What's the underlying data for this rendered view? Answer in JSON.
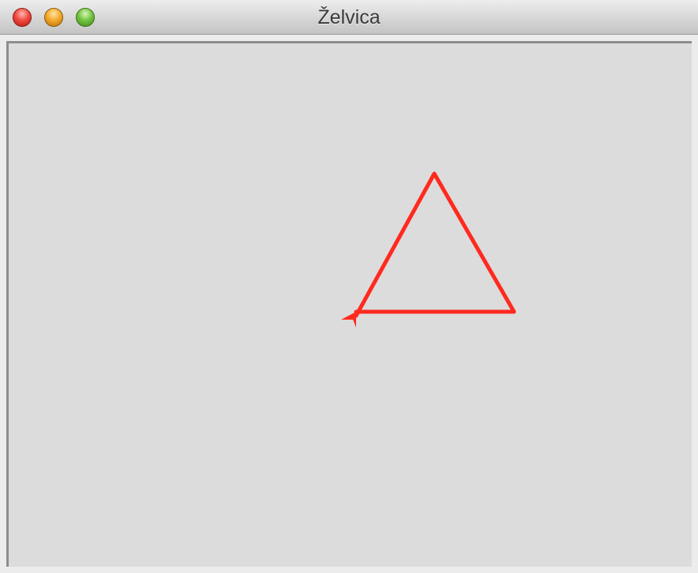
{
  "window": {
    "title": "Želvica"
  },
  "colors": {
    "pen": "#ff2a1f",
    "canvas_background": "#dcdcdc"
  },
  "icons": {
    "close": "close-button-icon",
    "minimize": "minimize-button-icon",
    "zoom": "zoom-button-icon",
    "turtle": "turtle-arrow-icon"
  }
}
